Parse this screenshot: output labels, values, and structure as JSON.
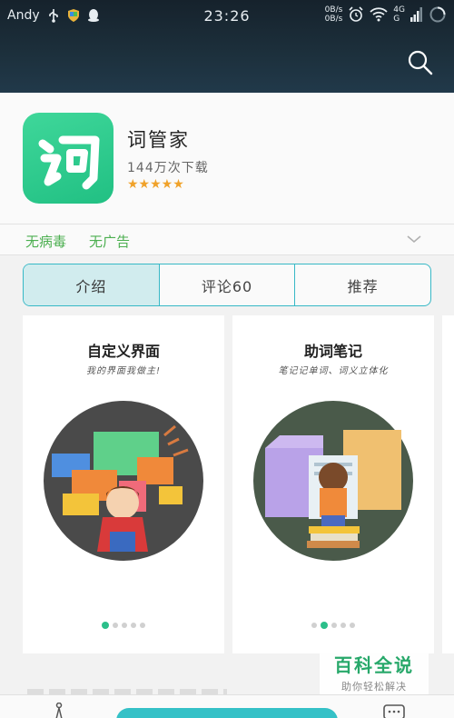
{
  "status_bar": {
    "carrier": "Andy",
    "time": "23:26",
    "speed_up": "0B/s",
    "speed_down": "0B/s",
    "network_top": "4G",
    "network_bottom": "G"
  },
  "app": {
    "name": "词管家",
    "downloads": "144万次下载",
    "rating_stars": "★★★★★",
    "icon_color": "#2fcf8d"
  },
  "badges": [
    "无病毒",
    "无广告"
  ],
  "tabs": [
    {
      "label": "介绍",
      "active": true
    },
    {
      "label": "评论60",
      "active": false
    },
    {
      "label": "推荐",
      "active": false
    }
  ],
  "screenshots": [
    {
      "title": "自定义界面",
      "subtitle": "我的界面我做主!"
    },
    {
      "title": "助词笔记",
      "subtitle": "笔记记单词、词义立体化"
    }
  ],
  "watermark": {
    "title": "百科全说",
    "subtitle": "助你轻松解决"
  },
  "colors": {
    "accent": "#35c1c7",
    "badge_green": "#4caf50",
    "star": "#f0a22a",
    "dot_active": "#2bbf8a"
  }
}
